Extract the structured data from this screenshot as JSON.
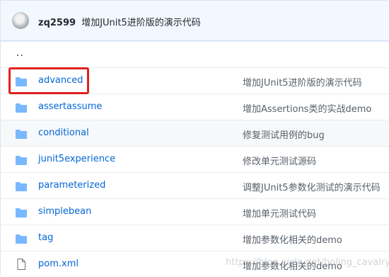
{
  "commit_header": {
    "user": "zq2599",
    "message": "增加JUnit5进阶版的演示代码"
  },
  "parent_dir": "..",
  "files": [
    {
      "name": "advanced",
      "type": "folder",
      "message": "增加JUnit5进阶版的演示代码",
      "highlighted": false,
      "boxed": true
    },
    {
      "name": "assertassume",
      "type": "folder",
      "message": "增加Assertions类的实战demo",
      "highlighted": false
    },
    {
      "name": "conditional",
      "type": "folder",
      "message": "修复测试用例的bug",
      "highlighted": true
    },
    {
      "name": "junit5experience",
      "type": "folder",
      "message": "修改单元测试源码",
      "highlighted": false
    },
    {
      "name": "parameterized",
      "type": "folder",
      "message": "调整JUnit5参数化测试的演示代码",
      "highlighted": false
    },
    {
      "name": "simplebean",
      "type": "folder",
      "message": "增加单元测试代码",
      "highlighted": false
    },
    {
      "name": "tag",
      "type": "folder",
      "message": "增加参数化相关的demo",
      "highlighted": false
    },
    {
      "name": "pom.xml",
      "type": "file",
      "message": "增加参数化相关的demo",
      "highlighted": false
    }
  ],
  "colors": {
    "folder_icon": "#79b8ff",
    "link": "#0366d6",
    "annotation_box": "#e02020",
    "header_bg": "#f1f8ff"
  },
  "watermark": "https://blog.csdn.net/boling_cavalry",
  "icons": {
    "folder": "folder-icon",
    "file": "file-icon"
  }
}
